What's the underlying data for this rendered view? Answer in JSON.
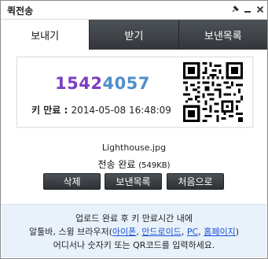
{
  "window": {
    "title": "퀵전송"
  },
  "tabs": [
    {
      "label": "보내기",
      "active": true
    },
    {
      "label": "받기",
      "active": false
    },
    {
      "label": "보낸목록",
      "active": false
    }
  ],
  "transfer": {
    "key_part1": "1542",
    "key_part2": "4057",
    "key_color_part1": "#7b3fc1",
    "key_color_part2": "#4f8fc9",
    "expire_label": "키 만료 : ",
    "expire_date": "2014-05-08",
    "expire_time": "16:48:09",
    "filename": "Lighthouse.jpg",
    "status_text": "전송 완료",
    "size_text": "(549KB)"
  },
  "buttons": {
    "delete": "삭제",
    "sent_list": "보낸목록",
    "restart": "처음으로"
  },
  "footer": {
    "line1": "업로드 완료 후 키 만료시간 내에",
    "line2_prefix": "알툴바, 스윙 브라우저(",
    "link_iphone": "아이폰",
    "sep1": ", ",
    "link_android": "안드로이드",
    "sep2": ", ",
    "link_pc": "PC",
    "sep3": ", ",
    "link_homepage": "홈페이지",
    "line2_suffix": ")",
    "line3": "어디서나 숫자키 또는 QR코드를 입력하세요."
  },
  "icons": {
    "pin": "pin-icon",
    "minimize": "minimize-icon",
    "close": "close-icon",
    "qr": "qr-code"
  }
}
